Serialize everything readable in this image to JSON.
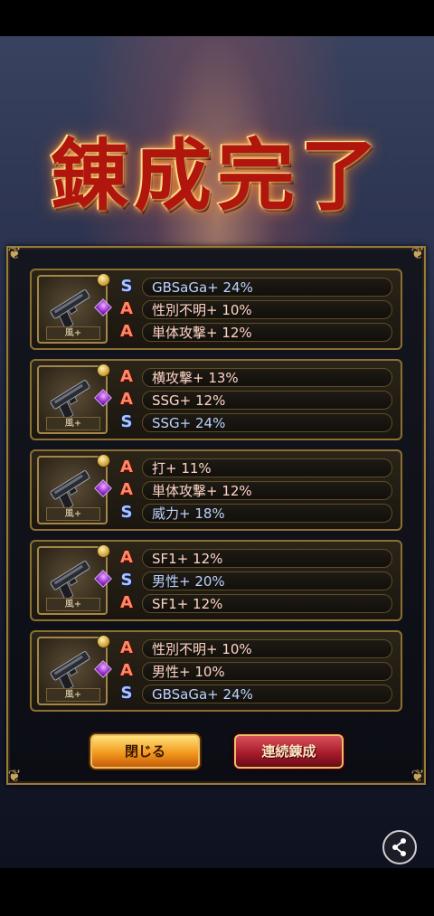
{
  "title": "錬成完了",
  "items": [
    {
      "element_label": "風+",
      "stats": [
        {
          "rank": "S",
          "text": "GBSaGa+ 24%"
        },
        {
          "rank": "A",
          "text": "性別不明+ 10%"
        },
        {
          "rank": "A",
          "text": "単体攻撃+ 12%"
        }
      ]
    },
    {
      "element_label": "風+",
      "stats": [
        {
          "rank": "A",
          "text": "横攻撃+ 13%"
        },
        {
          "rank": "A",
          "text": "SSG+ 12%"
        },
        {
          "rank": "S",
          "text": "SSG+ 24%"
        }
      ]
    },
    {
      "element_label": "風+",
      "stats": [
        {
          "rank": "A",
          "text": "打+ 11%"
        },
        {
          "rank": "A",
          "text": "単体攻撃+ 12%"
        },
        {
          "rank": "S",
          "text": "威力+ 18%"
        }
      ]
    },
    {
      "element_label": "風+",
      "stats": [
        {
          "rank": "A",
          "text": "SF1+ 12%"
        },
        {
          "rank": "S",
          "text": "男性+ 20%"
        },
        {
          "rank": "A",
          "text": "SF1+ 12%"
        }
      ]
    },
    {
      "element_label": "風+",
      "stats": [
        {
          "rank": "A",
          "text": "性別不明+ 10%"
        },
        {
          "rank": "A",
          "text": "男性+ 10%"
        },
        {
          "rank": "S",
          "text": "GBSaGa+ 24%"
        }
      ]
    }
  ],
  "buttons": {
    "close_label": "閉じる",
    "continue_label": "連続錬成"
  },
  "icons": {
    "weapon": "pistol-icon",
    "share": "share-icon"
  },
  "colors": {
    "rank_A": "#ff8866",
    "rank_S": "#a9c4ff",
    "frame_gold": "#9a7a3c"
  }
}
